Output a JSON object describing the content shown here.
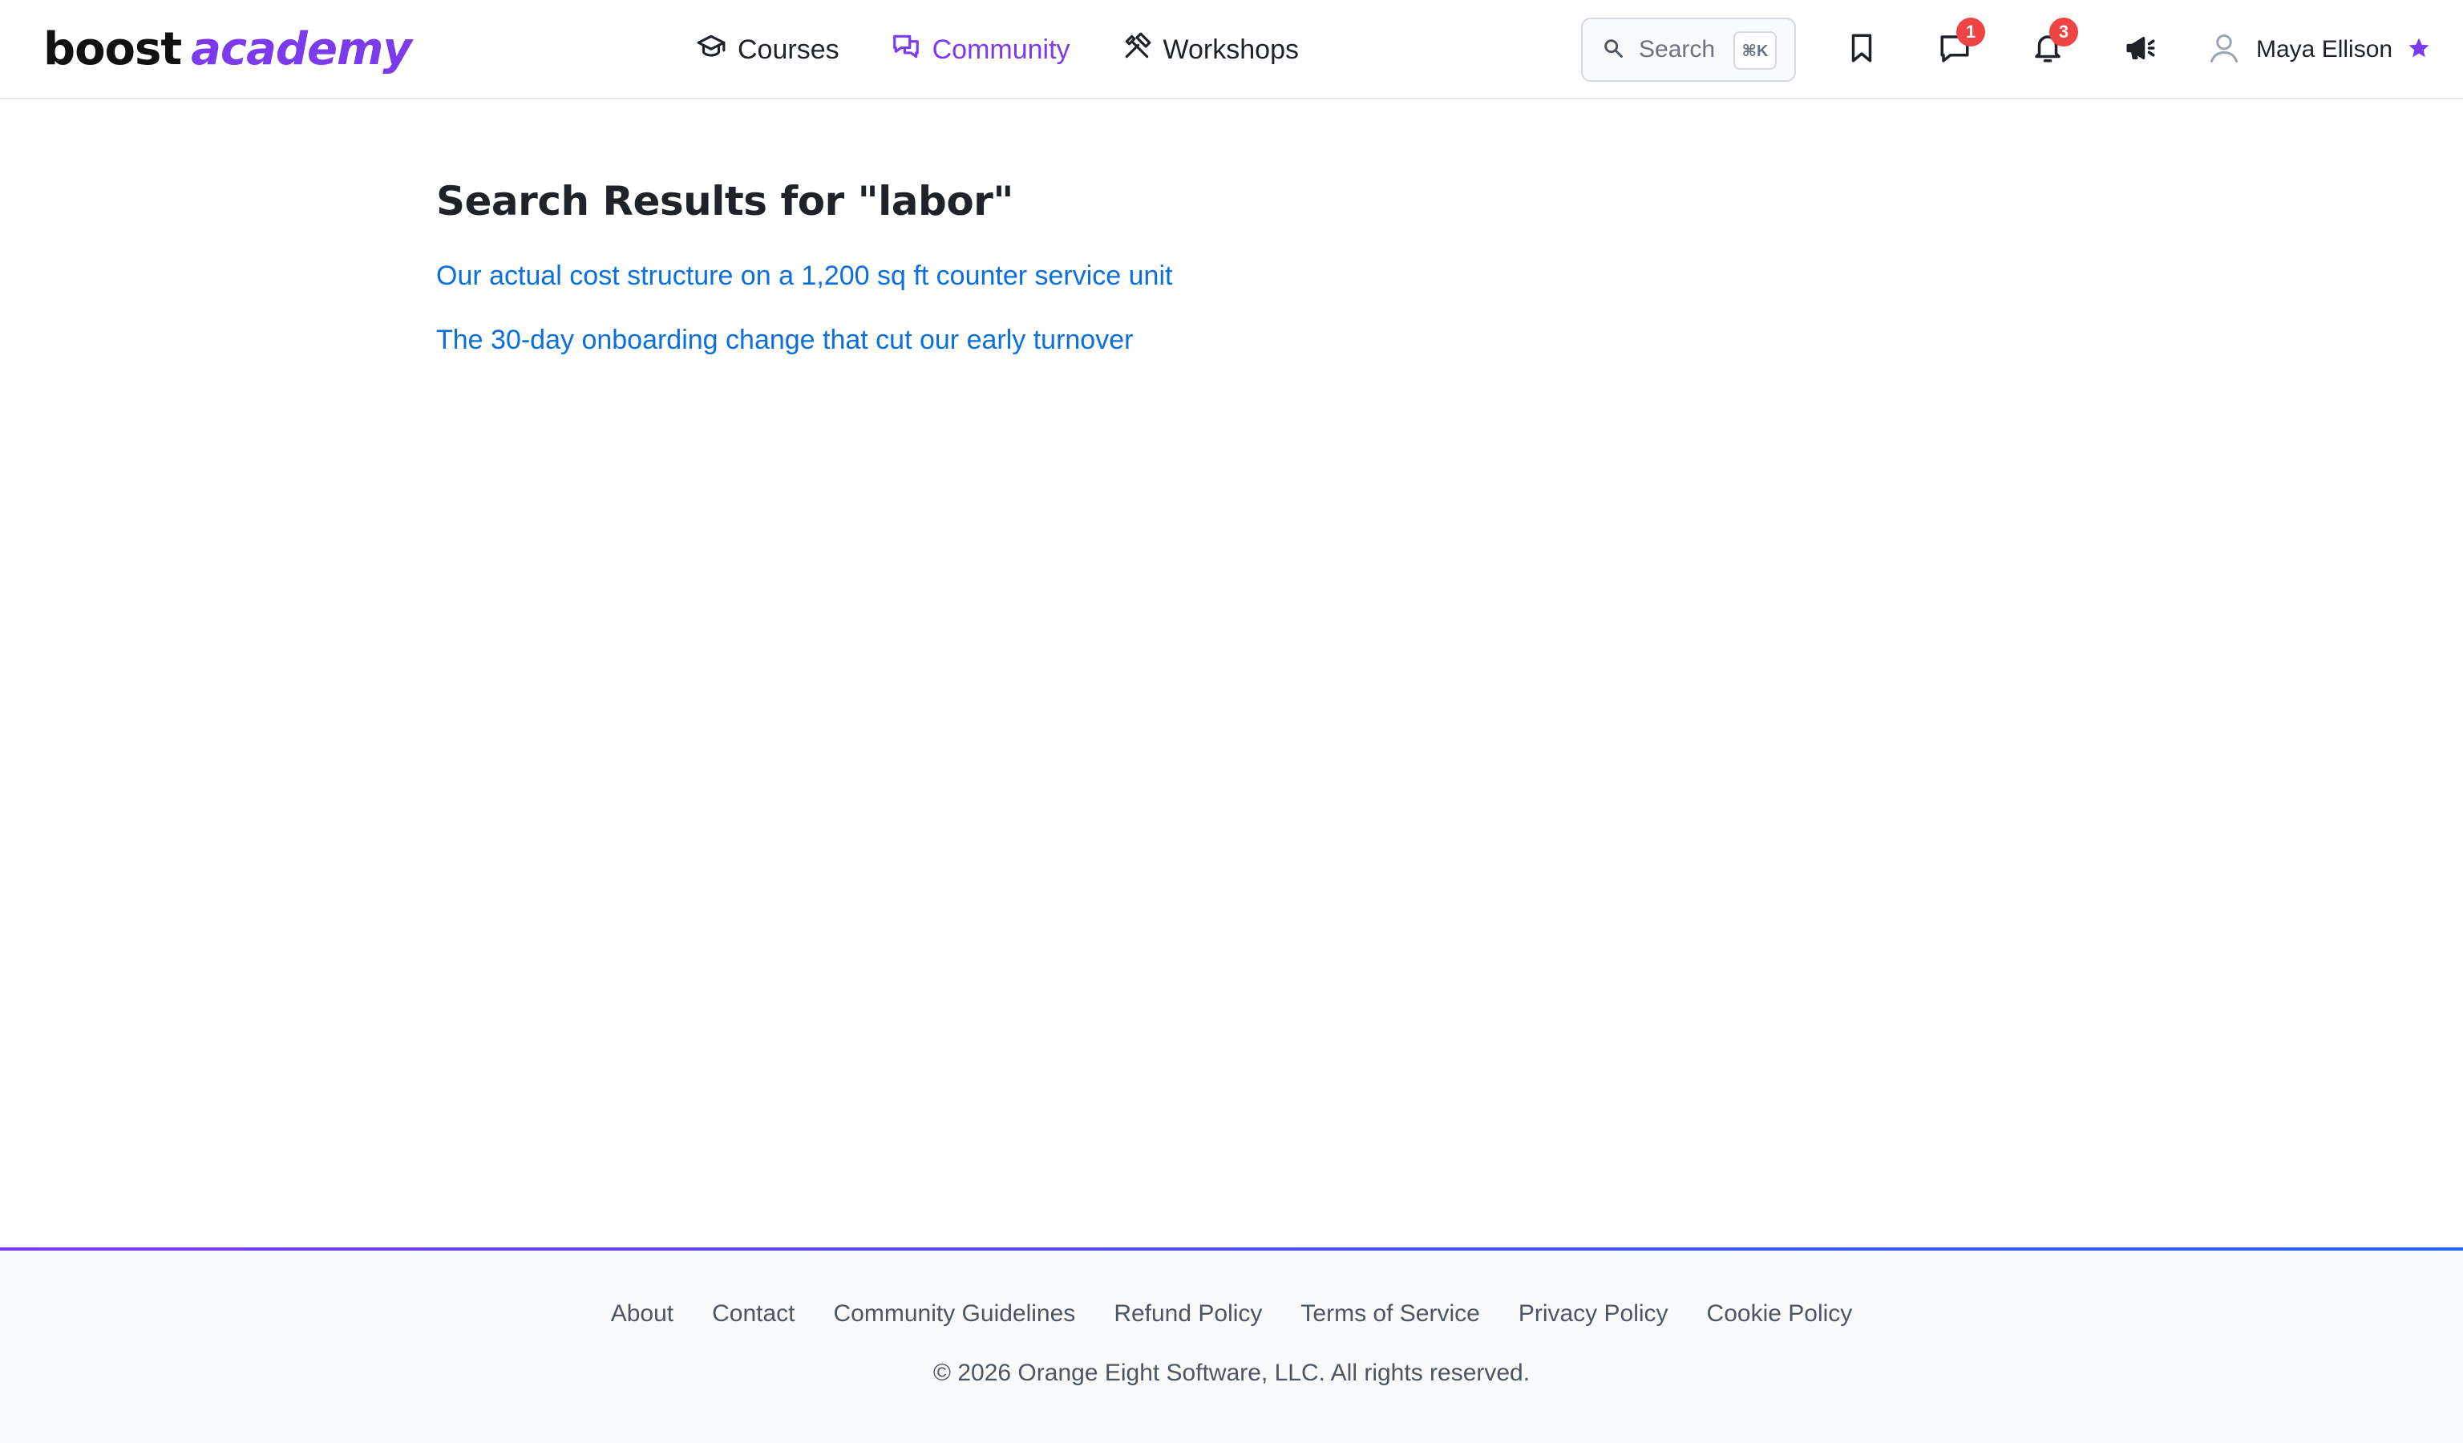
{
  "header": {
    "logo": {
      "part1": "boost",
      "part2": "academy"
    },
    "nav": [
      {
        "label": "Courses",
        "icon": "graduation-cap-icon",
        "active": false
      },
      {
        "label": "Community",
        "icon": "chat-bubbles-icon",
        "active": true
      },
      {
        "label": "Workshops",
        "icon": "tools-icon",
        "active": false
      }
    ],
    "search": {
      "placeholder": "Search",
      "shortcut": "⌘K"
    },
    "icons": {
      "bookmarks": "bookmark-icon",
      "messages": {
        "icon": "message-icon",
        "badge": "1"
      },
      "notifications": {
        "icon": "bell-icon",
        "badge": "3"
      },
      "announcements": "megaphone-icon"
    },
    "user": {
      "name": "Maya Ellison",
      "avatar": "user-avatar-icon",
      "status_icon": "star-icon"
    }
  },
  "main": {
    "title": "Search Results for \"labor\"",
    "results": [
      {
        "title": "Our actual cost structure on a 1,200 sq ft counter service unit"
      },
      {
        "title": "The 30-day onboarding change that cut our early turnover"
      }
    ]
  },
  "footer": {
    "links": [
      "About",
      "Contact",
      "Community Guidelines",
      "Refund Policy",
      "Terms of Service",
      "Privacy Policy",
      "Cookie Policy"
    ],
    "copyright": "© 2026 Orange Eight Software, LLC. All rights reserved."
  },
  "colors": {
    "accent": "#7c3aed",
    "link": "#0b6fe0",
    "badge": "#ef4444",
    "footer_gradient_end": "#2563eb"
  }
}
